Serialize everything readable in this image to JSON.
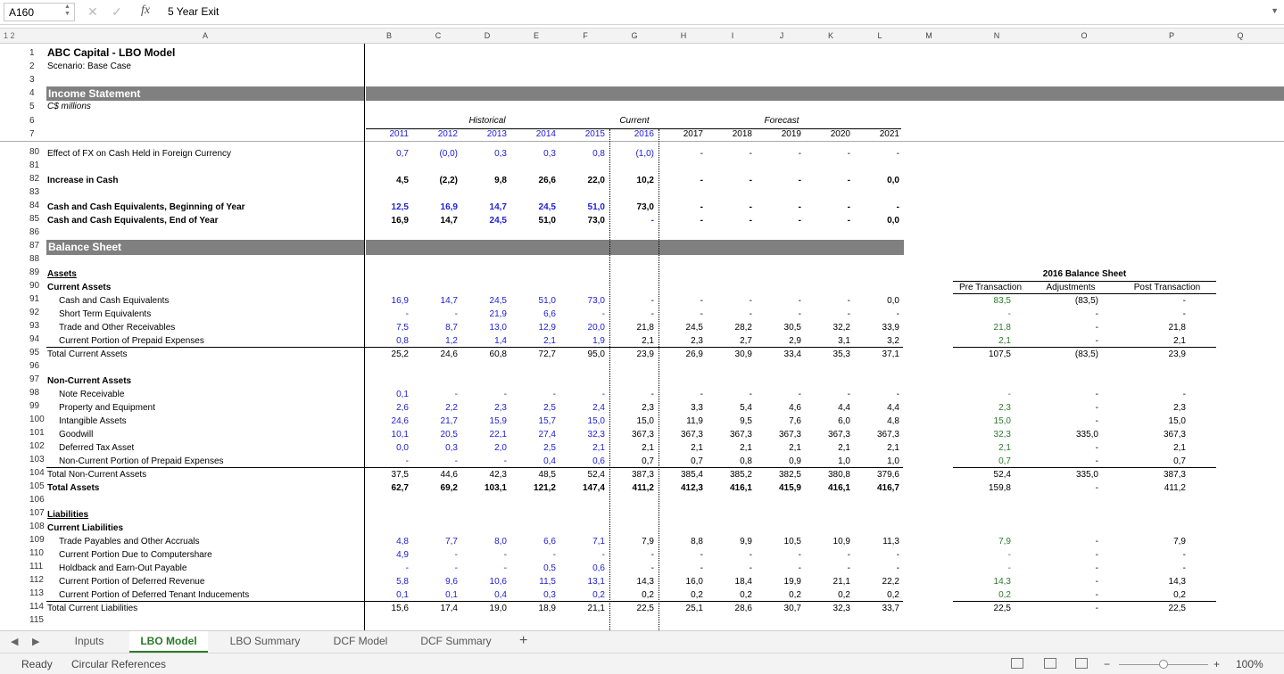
{
  "formula_bar": {
    "cell_ref": "A160",
    "formula": "5 Year Exit",
    "fx": "fx"
  },
  "group_levels": "1 2",
  "columns": [
    "A",
    "B",
    "C",
    "D",
    "E",
    "F",
    "G",
    "H",
    "I",
    "J",
    "K",
    "L",
    "M",
    "N",
    "O",
    "P",
    "Q"
  ],
  "title": "ABC Capital - LBO Model",
  "scenario": "Scenario: Base Case",
  "section_income": "Income Statement",
  "units": "C$ millions",
  "period_headers": {
    "historical": "Historical",
    "current": "Current",
    "forecast": "Forecast"
  },
  "years": [
    "2011",
    "2012",
    "2013",
    "2014",
    "2015",
    "2016",
    "2017",
    "2018",
    "2019",
    "2020",
    "2021"
  ],
  "section_balance": "Balance Sheet",
  "bs_2016": {
    "title": "2016 Balance Sheet",
    "pre": "Pre Transaction",
    "adj": "Adjustments",
    "post": "Post Transaction"
  },
  "rows": [
    {
      "n": "6"
    },
    {
      "n": "80",
      "label": "Effect of FX on Cash Held in Foreign Currency",
      "v": [
        "0,7",
        "(0,0)",
        "0,3",
        "0,3",
        "0,8",
        "(1,0)",
        "-",
        "-",
        "-",
        "-",
        "-"
      ]
    },
    {
      "n": "81"
    },
    {
      "n": "82",
      "label": "Increase in Cash",
      "bold": true,
      "v": [
        "4,5",
        "(2,2)",
        "9,8",
        "26,6",
        "22,0",
        "10,2",
        "-",
        "-",
        "-",
        "-",
        "0,0"
      ]
    },
    {
      "n": "83"
    },
    {
      "n": "84",
      "label": "Cash and Cash Equivalents, Beginning of Year",
      "bold": true,
      "v": [
        "12,5",
        "16,9",
        "14,7",
        "24,5",
        "51,0",
        "73,0",
        "-",
        "-",
        "-",
        "-",
        "-"
      ]
    },
    {
      "n": "85",
      "label": "Cash and Cash Equivalents, End of Year",
      "bold": true,
      "v": [
        "16,9",
        "14,7",
        "24,5",
        "51,0",
        "73,0",
        "-",
        "-",
        "-",
        "-",
        "-",
        "0,0"
      ]
    },
    {
      "n": "86"
    },
    {
      "n": "87"
    },
    {
      "n": "88"
    },
    {
      "n": "89",
      "label": "Assets"
    },
    {
      "n": "90",
      "label": "Current Assets"
    },
    {
      "n": "91",
      "label": "Cash and Cash Equivalents",
      "v": [
        "16,9",
        "14,7",
        "24,5",
        "51,0",
        "73,0",
        "-",
        "-",
        "-",
        "-",
        "-",
        "0,0"
      ],
      "bs": [
        "83,5",
        "(83,5)",
        "-"
      ]
    },
    {
      "n": "92",
      "label": "Short Term Equivalents",
      "v": [
        "-",
        "-",
        "21,9",
        "6,6",
        "-",
        "-",
        "-",
        "-",
        "-",
        "-",
        "-"
      ],
      "bs": [
        "-",
        "-",
        "-"
      ]
    },
    {
      "n": "93",
      "label": "Trade and Other Receivables",
      "v": [
        "7,5",
        "8,7",
        "13,0",
        "12,9",
        "20,0",
        "21,8",
        "24,5",
        "28,2",
        "30,5",
        "32,2",
        "33,9"
      ],
      "bs": [
        "21,8",
        "-",
        "21,8"
      ]
    },
    {
      "n": "94",
      "label": "Current Portion of Prepaid Expenses",
      "v": [
        "0,8",
        "1,2",
        "1,4",
        "2,1",
        "1,9",
        "2,1",
        "2,3",
        "2,7",
        "2,9",
        "3,1",
        "3,2"
      ],
      "bs": [
        "2,1",
        "-",
        "2,1"
      ]
    },
    {
      "n": "95",
      "label": "Total Current Assets",
      "v": [
        "25,2",
        "24,6",
        "60,8",
        "72,7",
        "95,0",
        "23,9",
        "26,9",
        "30,9",
        "33,4",
        "35,3",
        "37,1"
      ],
      "bs": [
        "107,5",
        "(83,5)",
        "23,9"
      ]
    },
    {
      "n": "96"
    },
    {
      "n": "97",
      "label": "Non-Current Assets"
    },
    {
      "n": "98",
      "label": "Note Receivable",
      "v": [
        "0,1",
        "-",
        "-",
        "-",
        "-",
        "-",
        "-",
        "-",
        "-",
        "-",
        "-"
      ],
      "bs": [
        "-",
        "-",
        "-"
      ]
    },
    {
      "n": "99",
      "label": "Property and Equipment",
      "v": [
        "2,6",
        "2,2",
        "2,3",
        "2,5",
        "2,4",
        "2,3",
        "3,3",
        "5,4",
        "4,6",
        "4,4",
        "4,4"
      ],
      "bs": [
        "2,3",
        "-",
        "2,3"
      ]
    },
    {
      "n": "100",
      "label": "Intangible Assets",
      "v": [
        "24,6",
        "21,7",
        "15,9",
        "15,7",
        "15,0",
        "15,0",
        "11,9",
        "9,5",
        "7,6",
        "6,0",
        "4,8"
      ],
      "bs": [
        "15,0",
        "-",
        "15,0"
      ]
    },
    {
      "n": "101",
      "label": "Goodwill",
      "v": [
        "10,1",
        "20,5",
        "22,1",
        "27,4",
        "32,3",
        "367,3",
        "367,3",
        "367,3",
        "367,3",
        "367,3",
        "367,3"
      ],
      "bs": [
        "32,3",
        "335,0",
        "367,3"
      ]
    },
    {
      "n": "102",
      "label": "Deferred Tax Asset",
      "v": [
        "0,0",
        "0,3",
        "2,0",
        "2,5",
        "2,1",
        "2,1",
        "2,1",
        "2,1",
        "2,1",
        "2,1",
        "2,1"
      ],
      "bs": [
        "2,1",
        "-",
        "2,1"
      ]
    },
    {
      "n": "103",
      "label": "Non-Current Portion of Prepaid Expenses",
      "v": [
        "-",
        "-",
        "-",
        "0,4",
        "0,6",
        "0,7",
        "0,7",
        "0,8",
        "0,9",
        "1,0",
        "1,0"
      ],
      "bs": [
        "0,7",
        "-",
        "0,7"
      ]
    },
    {
      "n": "104",
      "label": "Total Non-Current Assets",
      "v": [
        "37,5",
        "44,6",
        "42,3",
        "48,5",
        "52,4",
        "387,3",
        "385,4",
        "385,2",
        "382,5",
        "380,8",
        "379,6"
      ],
      "bs": [
        "52,4",
        "335,0",
        "387,3"
      ]
    },
    {
      "n": "105",
      "label": "Total Assets",
      "bold": true,
      "v": [
        "62,7",
        "69,2",
        "103,1",
        "121,2",
        "147,4",
        "411,2",
        "412,3",
        "416,1",
        "415,9",
        "416,1",
        "416,7"
      ],
      "bs": [
        "159,8",
        "-",
        "411,2"
      ]
    },
    {
      "n": "106"
    },
    {
      "n": "107",
      "label": "Liabilities"
    },
    {
      "n": "108",
      "label": "Current Liabilities"
    },
    {
      "n": "109",
      "label": "Trade Payables and Other Accruals",
      "v": [
        "4,8",
        "7,7",
        "8,0",
        "6,6",
        "7,1",
        "7,9",
        "8,8",
        "9,9",
        "10,5",
        "10,9",
        "11,3"
      ],
      "bs": [
        "7,9",
        "-",
        "7,9"
      ]
    },
    {
      "n": "110",
      "label": "Current Portion Due to Computershare",
      "v": [
        "4,9",
        "-",
        "-",
        "-",
        "-",
        "-",
        "-",
        "-",
        "-",
        "-",
        "-"
      ],
      "bs": [
        "-",
        "-",
        "-"
      ]
    },
    {
      "n": "111",
      "label": "Holdback and Earn-Out Payable",
      "v": [
        "-",
        "-",
        "-",
        "0,5",
        "0,6",
        "-",
        "-",
        "-",
        "-",
        "-",
        "-"
      ],
      "bs": [
        "-",
        "-",
        "-"
      ]
    },
    {
      "n": "112",
      "label": "Current Portion of Deferred Revenue",
      "v": [
        "5,8",
        "9,6",
        "10,6",
        "11,5",
        "13,1",
        "14,3",
        "16,0",
        "18,4",
        "19,9",
        "21,1",
        "22,2"
      ],
      "bs": [
        "14,3",
        "-",
        "14,3"
      ]
    },
    {
      "n": "113",
      "label": "Current Portion of Deferred Tenant Inducements",
      "v": [
        "0,1",
        "0,1",
        "0,4",
        "0,3",
        "0,2",
        "0,2",
        "0,2",
        "0,2",
        "0,2",
        "0,2",
        "0,2"
      ],
      "bs": [
        "0,2",
        "-",
        "0,2"
      ]
    },
    {
      "n": "114",
      "label": "Total Current Liabilities",
      "v": [
        "15,6",
        "17,4",
        "19,0",
        "18,9",
        "21,1",
        "22,5",
        "25,1",
        "28,6",
        "30,7",
        "32,3",
        "33,7"
      ],
      "bs": [
        "22,5",
        "-",
        "22,5"
      ]
    },
    {
      "n": "115"
    }
  ],
  "row_numbers_top": [
    "1",
    "2",
    "3",
    "4",
    "5"
  ],
  "tabs": [
    "Inputs",
    "LBO Model",
    "LBO Summary",
    "DCF Model",
    "DCF Summary"
  ],
  "active_tab": "LBO Model",
  "status": {
    "ready": "Ready",
    "circular": "Circular References",
    "zoom": "100%"
  }
}
